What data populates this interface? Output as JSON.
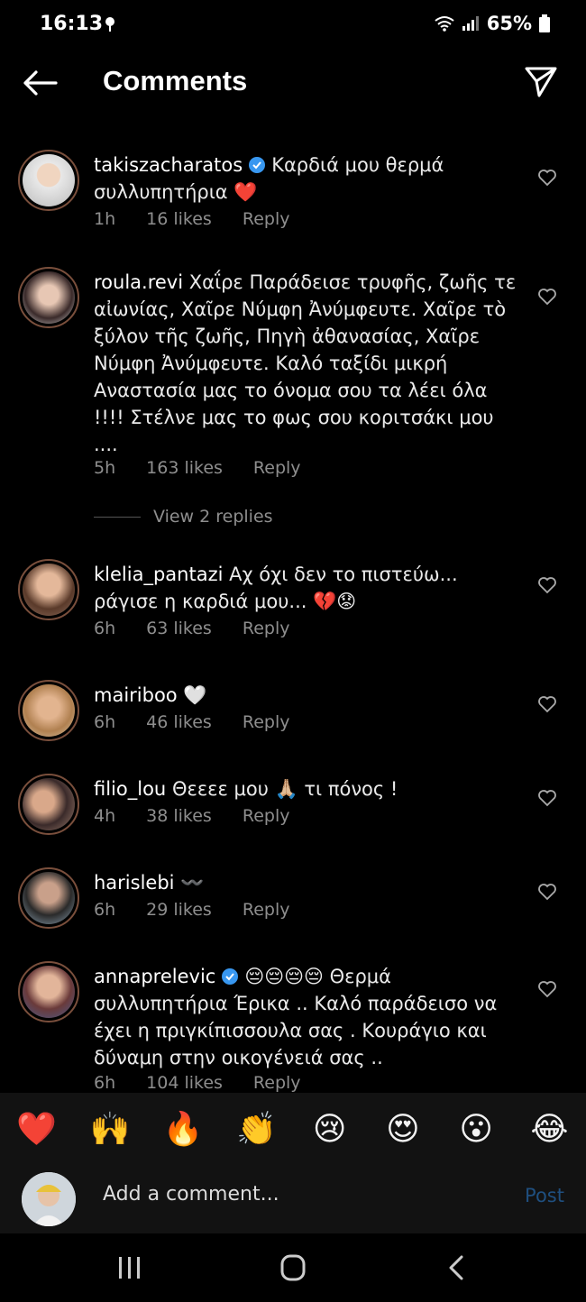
{
  "status": {
    "time": "16:13",
    "battery": "65%"
  },
  "header": {
    "title": "Comments"
  },
  "comments": [
    {
      "user": "takiszacharatos",
      "verified": true,
      "text": "Καρδιά μου θερμά συλλυπητήρια ❤️",
      "time": "1h",
      "likes": "16 likes",
      "reply": "Reply"
    },
    {
      "user": "roula.revi",
      "verified": false,
      "text": "Χαΐρε Παράδεισε τρυφῆς, ζωῆς τε αἰωνίας, Χαῖρε Νύμφη Ἀνύμφευτε. Χαῖρε τὸ ξύλον τῆς ζωῆς, Πηγὴ ἀθανασίας, Χαῖρε Νύμφη Ἀνύμφευτε. Καλό ταξίδι μικρή Αναστασία μας το όνομα σου τα λέει όλα !!!! Στέλνε μας το φως σου κοριτσάκι μου ....",
      "time": "5h",
      "likes": "163 likes",
      "reply": "Reply"
    },
    {
      "user": "klelia_pantazi",
      "verified": false,
      "text": "Αχ όχι δεν το πιστεύω... ράγισε η καρδιά μου... 💔😟",
      "time": "6h",
      "likes": "63 likes",
      "reply": "Reply"
    },
    {
      "user": "mairiboo",
      "verified": false,
      "text": "🤍",
      "time": "6h",
      "likes": "46 likes",
      "reply": "Reply"
    },
    {
      "user": "filio_lou",
      "verified": false,
      "text": "Θεεεε μου 🙏🏼 τι πόνος !",
      "time": "4h",
      "likes": "38 likes",
      "reply": "Reply"
    },
    {
      "user": "harislebi",
      "verified": false,
      "text": "〰️",
      "time": "6h",
      "likes": "29 likes",
      "reply": "Reply"
    },
    {
      "user": "annaprelevic",
      "verified": true,
      "text": "😔😔😔😔 Θερμά συλλυπητήρια Έρικα .. Καλό παράδεισο να έχει η πριγκίπισσουλα σας . Κουράγιο και δύναμη στην οικογένειά σας ..",
      "time": "6h",
      "likes": "104 likes",
      "reply": "Reply"
    }
  ],
  "view_replies": "View 2 replies",
  "emoji_bar": [
    "❤️",
    "🙌",
    "🔥",
    "👏",
    "😢",
    "😍",
    "😮",
    "😂"
  ],
  "composer": {
    "placeholder": "Add a comment...",
    "post_label": "Post"
  },
  "colors": {
    "background": "#000000",
    "muted": "#8e8e8e",
    "verified": "#3897f0",
    "post_disabled": "#1f4f7f"
  }
}
